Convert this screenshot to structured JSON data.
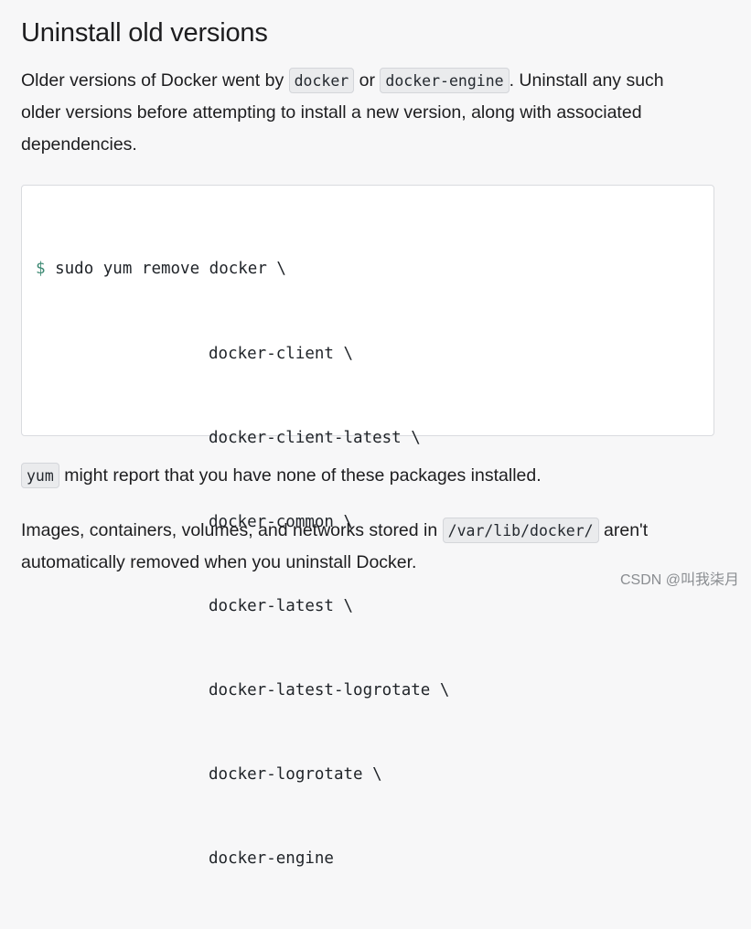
{
  "section": {
    "title": "Uninstall old versions"
  },
  "paragraph1": {
    "before": "Older versions of Docker went by ",
    "code1": "docker",
    "mid": " or ",
    "code2": "docker-engine",
    "after": ". Uninstall any such older versions before attempting to install a new version, along with associated dependencies."
  },
  "code_block": {
    "prompt": "$",
    "first_line": " sudo yum remove docker \\",
    "continuation_lines": [
      "docker-client \\",
      "docker-client-latest \\",
      "docker-common \\",
      "docker-latest \\",
      "docker-latest-logrotate \\",
      "docker-logrotate \\",
      "docker-engine"
    ]
  },
  "paragraph2": {
    "code": "yum",
    "text": " might report that you have none of these packages installed."
  },
  "paragraph3": {
    "before": "Images, containers, volumes, and networks stored in ",
    "code": "/var/lib/docker/",
    "after": " aren't automatically removed when you uninstall Docker."
  },
  "watermark": "CSDN @叫我柒月"
}
